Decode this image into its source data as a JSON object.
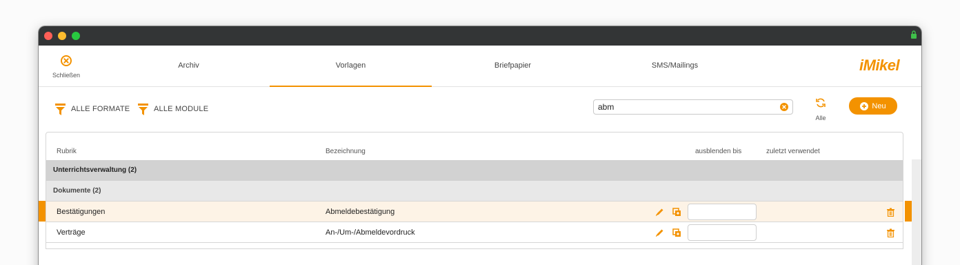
{
  "colors": {
    "accent": "#f39200",
    "titlebar": "#333536"
  },
  "nav": {
    "close_label": "Schließen",
    "tabs": [
      {
        "label": "Archiv",
        "active": false
      },
      {
        "label": "Vorlagen",
        "active": true
      },
      {
        "label": "Briefpapier",
        "active": false
      },
      {
        "label": "SMS/Mailings",
        "active": false
      }
    ],
    "logo": "iMikel"
  },
  "toolbar": {
    "filter_formats": "ALLE FORMATE",
    "filter_modules": "ALLE MODULE",
    "search_value": "abm",
    "refresh_label": "Alle",
    "new_label": "Neu"
  },
  "table": {
    "columns": {
      "rubrik": "Rubrik",
      "bezeichnung": "Bezeichnung",
      "ausblenden": "ausblenden bis",
      "zuletzt": "zuletzt verwendet"
    },
    "group": "Unterrichtsverwaltung (2)",
    "subgroup": "Dokumente (2)",
    "rows": [
      {
        "rubrik": "Bestätigungen",
        "bezeichnung": "Abmeldebestätigung",
        "ausblenden": "",
        "zuletzt": "",
        "selected": true
      },
      {
        "rubrik": "Verträge",
        "bezeichnung": "An-/Um-/Abmeldevordruck",
        "ausblenden": "",
        "zuletzt": "",
        "selected": false
      }
    ]
  }
}
